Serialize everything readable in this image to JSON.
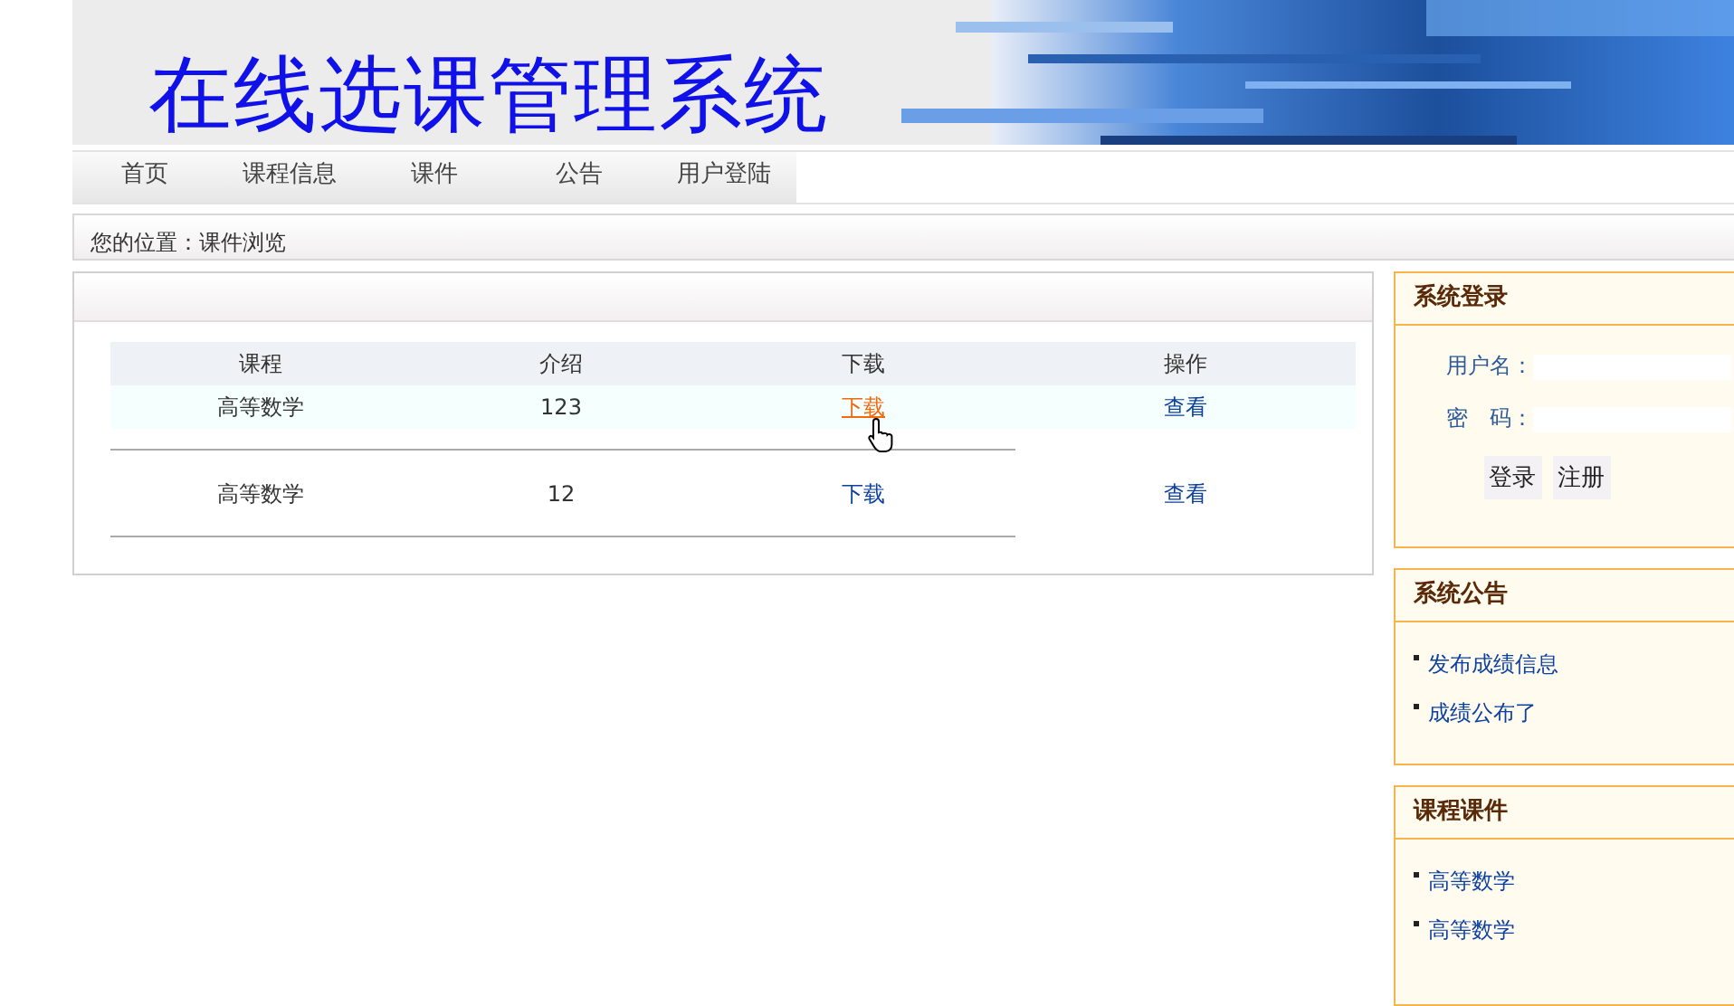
{
  "header": {
    "title": "在线选课管理系统"
  },
  "nav": [
    {
      "label": "首页"
    },
    {
      "label": "课程信息"
    },
    {
      "label": "课件"
    },
    {
      "label": "公告"
    },
    {
      "label": "用户登陆"
    }
  ],
  "breadcrumb": "您的位置：课件浏览",
  "table": {
    "columns": [
      "课程",
      "介绍",
      "下载",
      "操作"
    ],
    "rows": [
      {
        "course": "高等数学",
        "intro": "123",
        "download": "下载",
        "action": "查看",
        "hovered": true
      },
      {
        "course": "高等数学",
        "intro": "12",
        "download": "下载",
        "action": "查看",
        "hovered": false
      }
    ]
  },
  "login": {
    "title": "系统登录",
    "fields": [
      {
        "label": "用户名："
      },
      {
        "label": "密　码："
      }
    ],
    "buttons": [
      "登录",
      "注册"
    ]
  },
  "notices": {
    "title": "系统公告",
    "items": [
      "发布成绩信息",
      "成绩公布了"
    ]
  },
  "courseware": {
    "title": "课程课件",
    "items": [
      "高等数学",
      "高等数学"
    ]
  }
}
